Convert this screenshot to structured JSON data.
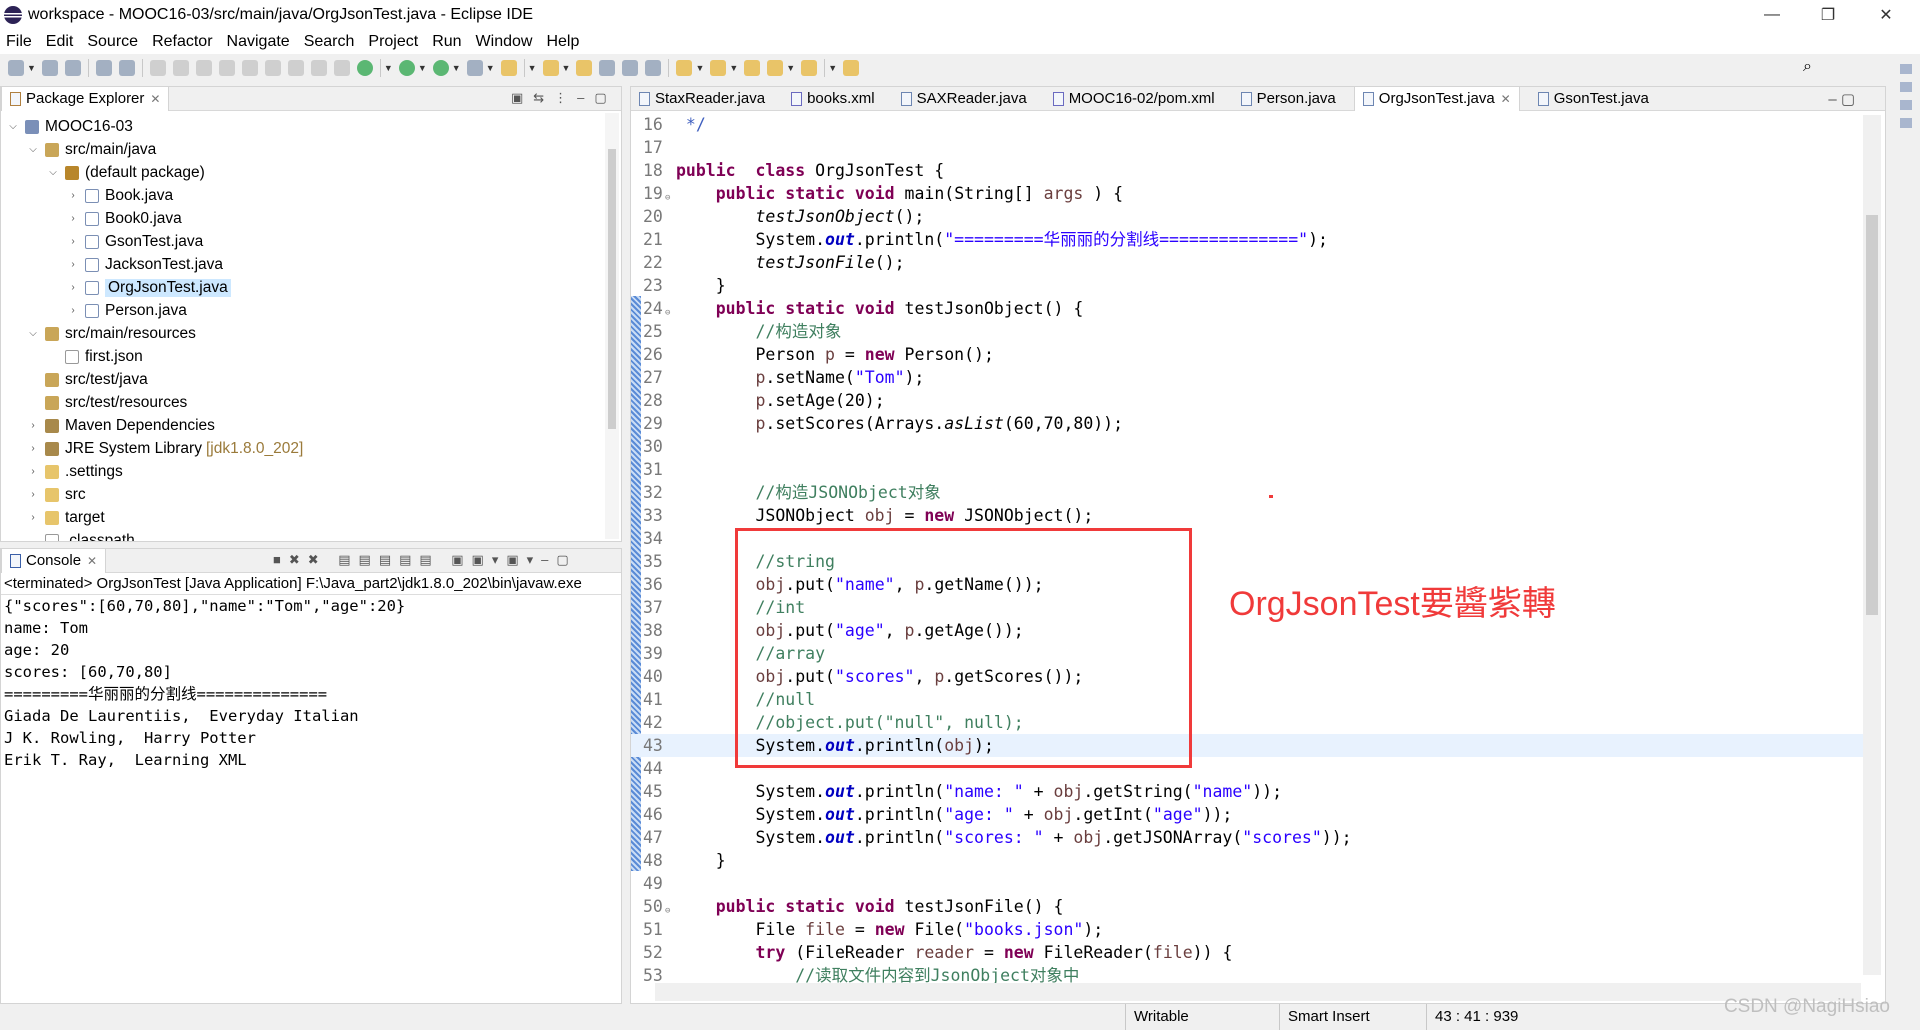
{
  "window": {
    "title": "workspace - MOOC16-03/src/main/java/OrgJsonTest.java - Eclipse IDE",
    "minimize": "—",
    "restore": "❐",
    "close": "✕"
  },
  "menu": [
    "File",
    "Edit",
    "Source",
    "Refactor",
    "Navigate",
    "Search",
    "Project",
    "Run",
    "Window",
    "Help"
  ],
  "toolbar_icons": [
    "new-wizard-icon",
    "save-icon",
    "save-all-icon",
    "open-console-icon",
    "skip-breakpoints-icon",
    "resume-icon",
    "suspend-icon",
    "terminate-icon",
    "disconnect-icon",
    "step-into-icon",
    "step-over-icon",
    "step-return-icon",
    "drop-to-frame-icon",
    "use-step-filters-icon",
    "debug-icon",
    "run-icon",
    "coverage-icon",
    "external-tools-icon",
    "open-type-icon",
    "search-icon",
    "toggle-ant-editor-icon",
    "mark-occurrences-icon",
    "toggle-block-selection-icon",
    "show-whitespace-icon",
    "next-annotation-icon",
    "previous-annotation-icon",
    "last-edit-icon",
    "back-icon",
    "forward-icon",
    "pin-editor-icon"
  ],
  "package_explorer": {
    "tab": "Package Explorer",
    "tree": [
      {
        "label": "MOOC16-03",
        "level": 0,
        "state": "expanded",
        "icon": "project"
      },
      {
        "label": "src/main/java",
        "level": 1,
        "state": "expanded",
        "icon": "srcfolder"
      },
      {
        "label": "(default package)",
        "level": 2,
        "state": "expanded",
        "icon": "package"
      },
      {
        "label": "Book.java",
        "level": 3,
        "state": "collapsed",
        "icon": "java"
      },
      {
        "label": "Book0.java",
        "level": 3,
        "state": "collapsed",
        "icon": "java"
      },
      {
        "label": "GsonTest.java",
        "level": 3,
        "state": "collapsed",
        "icon": "java"
      },
      {
        "label": "JacksonTest.java",
        "level": 3,
        "state": "collapsed",
        "icon": "java"
      },
      {
        "label": "OrgJsonTest.java",
        "level": 3,
        "state": "collapsed",
        "icon": "java",
        "selected": true
      },
      {
        "label": "Person.java",
        "level": 3,
        "state": "collapsed",
        "icon": "java"
      },
      {
        "label": "src/main/resources",
        "level": 1,
        "state": "expanded",
        "icon": "srcfolder"
      },
      {
        "label": "first.json",
        "level": 2,
        "state": "leaf",
        "icon": "file"
      },
      {
        "label": "src/test/java",
        "level": 1,
        "state": "leaf",
        "icon": "srcfolder"
      },
      {
        "label": "src/test/resources",
        "level": 1,
        "state": "leaf",
        "icon": "srcfolder"
      },
      {
        "label": "Maven Dependencies",
        "level": 1,
        "state": "collapsed",
        "icon": "library"
      },
      {
        "label": "JRE System Library",
        "decoration": "[jdk1.8.0_202]",
        "level": 1,
        "state": "collapsed",
        "icon": "library"
      },
      {
        "label": ".settings",
        "level": 1,
        "state": "collapsed",
        "icon": "folder"
      },
      {
        "label": "src",
        "level": 1,
        "state": "collapsed",
        "icon": "folder"
      },
      {
        "label": "target",
        "level": 1,
        "state": "collapsed",
        "icon": "folder"
      },
      {
        "label": ".classpath",
        "level": 1,
        "state": "leaf",
        "icon": "file"
      }
    ]
  },
  "console": {
    "tab": "Console",
    "status": "<terminated> OrgJsonTest [Java Application] F:\\Java_part2\\jdk1.8.0_202\\bin\\javaw.exe",
    "output": [
      "{\"scores\":[60,70,80],\"name\":\"Tom\",\"age\":20}",
      "name: Tom",
      "age: 20",
      "scores: [60,70,80]",
      "=========华丽丽的分割线==============",
      "Giada De Laurentiis,  Everyday Italian",
      "J K. Rowling,  Harry Potter",
      "Erik T. Ray,  Learning XML"
    ]
  },
  "editor": {
    "tabs": [
      {
        "label": "StaxReader.java",
        "icon": "java"
      },
      {
        "label": "books.xml",
        "icon": "xml"
      },
      {
        "label": "SAXReader.java",
        "icon": "java"
      },
      {
        "label": "MOOC16-02/pom.xml",
        "icon": "maven"
      },
      {
        "label": "Person.java",
        "icon": "java"
      },
      {
        "label": "OrgJsonTest.java",
        "icon": "java",
        "active": true
      },
      {
        "label": "GsonTest.java",
        "icon": "java"
      }
    ],
    "current_line": 43,
    "lines": [
      {
        "n": "16",
        "t": [
          [
            "jd",
            " */"
          ]
        ]
      },
      {
        "n": "17",
        "t": []
      },
      {
        "n": "18",
        "t": [
          [
            "k",
            "public"
          ],
          [
            "",
            "  "
          ],
          [
            "k",
            "class"
          ],
          [
            "",
            " OrgJsonTest {"
          ]
        ]
      },
      {
        "n": "19",
        "fold": true,
        "t": [
          [
            "",
            "    "
          ],
          [
            "k",
            "public"
          ],
          [
            "",
            " "
          ],
          [
            "k",
            "static"
          ],
          [
            "",
            " "
          ],
          [
            "k",
            "void"
          ],
          [
            "",
            " main(String[] "
          ],
          [
            "v",
            "args"
          ],
          [
            "",
            " ) {"
          ]
        ]
      },
      {
        "n": "20",
        "t": [
          [
            "",
            "        "
          ],
          [
            "i",
            "testJsonObject"
          ],
          [
            "",
            "();"
          ]
        ]
      },
      {
        "n": "21",
        "t": [
          [
            "",
            "        System."
          ],
          [
            "f",
            "out"
          ],
          [
            "",
            ".println("
          ],
          [
            "s",
            "\"=========华丽丽的分割线==============\""
          ],
          [
            "",
            ");"
          ]
        ]
      },
      {
        "n": "22",
        "t": [
          [
            "",
            "        "
          ],
          [
            "i",
            "testJsonFile"
          ],
          [
            "",
            "();"
          ]
        ]
      },
      {
        "n": "23",
        "t": [
          [
            "",
            "    }"
          ]
        ]
      },
      {
        "n": "24",
        "fold": true,
        "t": [
          [
            "",
            "    "
          ],
          [
            "k",
            "public"
          ],
          [
            "",
            " "
          ],
          [
            "k",
            "static"
          ],
          [
            "",
            " "
          ],
          [
            "k",
            "void"
          ],
          [
            "",
            " testJsonObject() {"
          ]
        ]
      },
      {
        "n": "25",
        "t": [
          [
            "",
            "        "
          ],
          [
            "c",
            "//构造对象"
          ]
        ]
      },
      {
        "n": "26",
        "t": [
          [
            "",
            "        Person "
          ],
          [
            "v",
            "p"
          ],
          [
            "",
            " = "
          ],
          [
            "k",
            "new"
          ],
          [
            "",
            " Person();"
          ]
        ]
      },
      {
        "n": "27",
        "t": [
          [
            "",
            "        "
          ],
          [
            "v",
            "p"
          ],
          [
            "",
            ".setName("
          ],
          [
            "s",
            "\"Tom\""
          ],
          [
            "",
            ");"
          ]
        ]
      },
      {
        "n": "28",
        "t": [
          [
            "",
            "        "
          ],
          [
            "v",
            "p"
          ],
          [
            "",
            ".setAge(20);"
          ]
        ]
      },
      {
        "n": "29",
        "t": [
          [
            "",
            "        "
          ],
          [
            "v",
            "p"
          ],
          [
            "",
            ".setScores(Arrays."
          ],
          [
            "i",
            "asList"
          ],
          [
            "",
            "(60,70,80));"
          ]
        ]
      },
      {
        "n": "30",
        "t": []
      },
      {
        "n": "31",
        "t": []
      },
      {
        "n": "32",
        "t": [
          [
            "",
            "        "
          ],
          [
            "c",
            "//构造JSONObject对象"
          ]
        ]
      },
      {
        "n": "33",
        "t": [
          [
            "",
            "        JSONObject "
          ],
          [
            "v",
            "obj"
          ],
          [
            "",
            " = "
          ],
          [
            "k",
            "new"
          ],
          [
            "",
            " JSONObject();"
          ]
        ]
      },
      {
        "n": "34",
        "t": []
      },
      {
        "n": "35",
        "t": [
          [
            "",
            "        "
          ],
          [
            "c",
            "//string"
          ]
        ]
      },
      {
        "n": "36",
        "t": [
          [
            "",
            "        "
          ],
          [
            "v",
            "obj"
          ],
          [
            "",
            ".put("
          ],
          [
            "s",
            "\"name\""
          ],
          [
            "",
            ", "
          ],
          [
            "v",
            "p"
          ],
          [
            "",
            ".getName());"
          ]
        ]
      },
      {
        "n": "37",
        "t": [
          [
            "",
            "        "
          ],
          [
            "c",
            "//int"
          ]
        ]
      },
      {
        "n": "38",
        "t": [
          [
            "",
            "        "
          ],
          [
            "v",
            "obj"
          ],
          [
            "",
            ".put("
          ],
          [
            "s",
            "\"age\""
          ],
          [
            "",
            ", "
          ],
          [
            "v",
            "p"
          ],
          [
            "",
            ".getAge());"
          ]
        ]
      },
      {
        "n": "39",
        "t": [
          [
            "",
            "        "
          ],
          [
            "c",
            "//array"
          ]
        ]
      },
      {
        "n": "40",
        "t": [
          [
            "",
            "        "
          ],
          [
            "v",
            "obj"
          ],
          [
            "",
            ".put("
          ],
          [
            "s",
            "\"scores\""
          ],
          [
            "",
            ", "
          ],
          [
            "v",
            "p"
          ],
          [
            "",
            ".getScores());"
          ]
        ]
      },
      {
        "n": "41",
        "t": [
          [
            "",
            "        "
          ],
          [
            "c",
            "//null"
          ]
        ]
      },
      {
        "n": "42",
        "t": [
          [
            "",
            "        "
          ],
          [
            "c",
            "//object.put(\"null\", null);"
          ]
        ]
      },
      {
        "n": "43",
        "t": [
          [
            "",
            "        System."
          ],
          [
            "f",
            "out"
          ],
          [
            "",
            ".println("
          ],
          [
            "v",
            "obj"
          ],
          [
            "",
            ");"
          ]
        ]
      },
      {
        "n": "44",
        "t": []
      },
      {
        "n": "45",
        "t": [
          [
            "",
            "        System."
          ],
          [
            "f",
            "out"
          ],
          [
            "",
            ".println("
          ],
          [
            "s",
            "\"name: \""
          ],
          [
            "",
            " + "
          ],
          [
            "v",
            "obj"
          ],
          [
            "",
            ".getString("
          ],
          [
            "s",
            "\"name\""
          ],
          [
            "",
            "));"
          ]
        ]
      },
      {
        "n": "46",
        "t": [
          [
            "",
            "        System."
          ],
          [
            "f",
            "out"
          ],
          [
            "",
            ".println("
          ],
          [
            "s",
            "\"age: \""
          ],
          [
            "",
            " + "
          ],
          [
            "v",
            "obj"
          ],
          [
            "",
            ".getInt("
          ],
          [
            "s",
            "\"age\""
          ],
          [
            "",
            "));"
          ]
        ]
      },
      {
        "n": "47",
        "t": [
          [
            "",
            "        System."
          ],
          [
            "f",
            "out"
          ],
          [
            "",
            ".println("
          ],
          [
            "s",
            "\"scores: \""
          ],
          [
            "",
            " + "
          ],
          [
            "v",
            "obj"
          ],
          [
            "",
            ".getJSONArray("
          ],
          [
            "s",
            "\"scores\""
          ],
          [
            "",
            "));"
          ]
        ]
      },
      {
        "n": "48",
        "t": [
          [
            "",
            "    }"
          ]
        ]
      },
      {
        "n": "49",
        "t": []
      },
      {
        "n": "50",
        "fold": true,
        "t": [
          [
            "",
            "    "
          ],
          [
            "k",
            "public"
          ],
          [
            "",
            " "
          ],
          [
            "k",
            "static"
          ],
          [
            "",
            " "
          ],
          [
            "k",
            "void"
          ],
          [
            "",
            " testJsonFile() {"
          ]
        ]
      },
      {
        "n": "51",
        "t": [
          [
            "",
            "        File "
          ],
          [
            "v",
            "file"
          ],
          [
            "",
            " = "
          ],
          [
            "k",
            "new"
          ],
          [
            "",
            " File("
          ],
          [
            "s",
            "\"books.json\""
          ],
          [
            "",
            ");"
          ]
        ]
      },
      {
        "n": "52",
        "t": [
          [
            "",
            "        "
          ],
          [
            "k",
            "try"
          ],
          [
            "",
            " (FileReader "
          ],
          [
            "v",
            "reader"
          ],
          [
            "",
            " = "
          ],
          [
            "k",
            "new"
          ],
          [
            "",
            " FileReader("
          ],
          [
            "v",
            "file"
          ],
          [
            "",
            ")) {"
          ]
        ]
      },
      {
        "n": "53",
        "t": [
          [
            "",
            "            "
          ],
          [
            "c",
            "//读取文件内容到JsonObject对象中"
          ]
        ]
      }
    ]
  },
  "annotation": {
    "text": "OrgJsonTest要醬紫轉",
    "color": "#f03a3a"
  },
  "status": {
    "writable": "Writable",
    "insert_mode": "Smart Insert",
    "position": "43 : 41 : 939"
  },
  "watermark": "CSDN @NagiHsiao",
  "colors": {
    "keyword": "#7f0055",
    "string": "#2a00ff",
    "comment": "#3f7f5f",
    "field": "#0000c0",
    "local": "#6a3e3e",
    "selection": "#cde8ff",
    "current_line": "#e8f2fe"
  }
}
